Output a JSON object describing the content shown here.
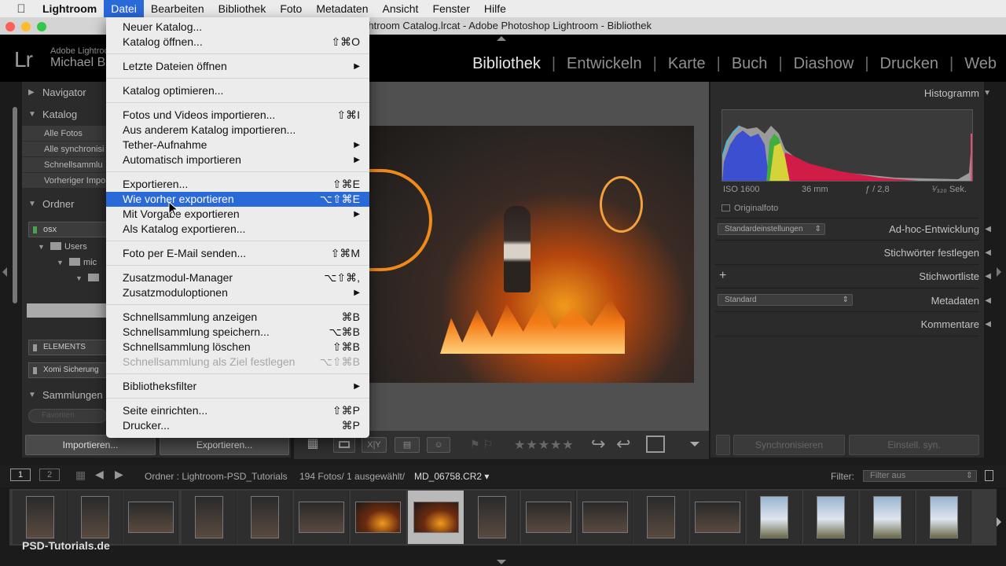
{
  "menubar": {
    "apple": "",
    "items": [
      "Lightroom",
      "Datei",
      "Bearbeiten",
      "Bibliothek",
      "Foto",
      "Metadaten",
      "Ansicht",
      "Fenster",
      "Hilfe"
    ]
  },
  "window": {
    "title": "Lightroom Catalog.lrcat - Adobe Photoshop Lightroom - Bibliothek"
  },
  "identity": {
    "logo": "Lr",
    "brand": "Adobe Lightroom",
    "user": "Michael B"
  },
  "modules": [
    "Bibliothek",
    "Entwickeln",
    "Karte",
    "Buch",
    "Diashow",
    "Drucken",
    "Web"
  ],
  "left_panel": {
    "navigator": "Navigator",
    "katalog": "Katalog",
    "katalog_items": [
      "Alle Fotos",
      "Alle synchronisi",
      "Schnellsammlu",
      "Vorheriger Impo"
    ],
    "ordner": "Ordner",
    "volume": "osx",
    "tree": [
      "Users",
      "mic"
    ],
    "volume2": "ELEMENTS",
    "volume3": "Xomi Sicherung",
    "sammlungen": "Sammlungen",
    "search_placeholder": "Favoriten",
    "import_btn": "Importieren...",
    "export_btn": "Exportieren..."
  },
  "dropdown": {
    "items": [
      {
        "label": "Neuer Katalog...",
        "shortcut": "",
        "sub": false,
        "state": "normal"
      },
      {
        "label": "Katalog öffnen...",
        "shortcut": "⇧⌘O",
        "sub": false,
        "state": "normal"
      },
      {
        "label": "Letzte Dateien öffnen",
        "shortcut": "",
        "sub": true,
        "state": "normal"
      },
      {
        "label": "Katalog optimieren...",
        "shortcut": "",
        "sub": false,
        "state": "normal"
      },
      {
        "label": "Fotos und Videos importieren...",
        "shortcut": "⇧⌘I",
        "sub": false,
        "state": "normal"
      },
      {
        "label": "Aus anderem Katalog importieren...",
        "shortcut": "",
        "sub": false,
        "state": "normal"
      },
      {
        "label": "Tether-Aufnahme",
        "shortcut": "",
        "sub": true,
        "state": "normal"
      },
      {
        "label": "Automatisch importieren",
        "shortcut": "",
        "sub": true,
        "state": "normal"
      },
      {
        "label": "Exportieren...",
        "shortcut": "⇧⌘E",
        "sub": false,
        "state": "normal"
      },
      {
        "label": "Wie vorher exportieren",
        "shortcut": "⌥⇧⌘E",
        "sub": false,
        "state": "highlighted"
      },
      {
        "label": "Mit Vorgabe exportieren",
        "shortcut": "",
        "sub": true,
        "state": "normal"
      },
      {
        "label": "Als Katalog exportieren...",
        "shortcut": "",
        "sub": false,
        "state": "normal"
      },
      {
        "label": "Foto per E-Mail senden...",
        "shortcut": "⇧⌘M",
        "sub": false,
        "state": "normal"
      },
      {
        "label": "Zusatzmodul-Manager",
        "shortcut": "⌥⇧⌘,",
        "sub": false,
        "state": "normal"
      },
      {
        "label": "Zusatzmoduloptionen",
        "shortcut": "",
        "sub": true,
        "state": "normal"
      },
      {
        "label": "Schnellsammlung anzeigen",
        "shortcut": "⌘B",
        "sub": false,
        "state": "normal"
      },
      {
        "label": "Schnellsammlung speichern...",
        "shortcut": "⌥⌘B",
        "sub": false,
        "state": "normal"
      },
      {
        "label": "Schnellsammlung löschen",
        "shortcut": "⇧⌘B",
        "sub": false,
        "state": "normal"
      },
      {
        "label": "Schnellsammlung als Ziel festlegen",
        "shortcut": "⌥⇧⌘B",
        "sub": false,
        "state": "disabled"
      },
      {
        "label": "Bibliotheksfilter",
        "shortcut": "",
        "sub": true,
        "state": "normal"
      },
      {
        "label": "Seite einrichten...",
        "shortcut": "⇧⌘P",
        "sub": false,
        "state": "normal"
      },
      {
        "label": "Drucker...",
        "shortcut": "⌘P",
        "sub": false,
        "state": "normal"
      }
    ]
  },
  "right_panel": {
    "histogram": "Histogramm",
    "iso": "ISO 1600",
    "focal": "36 mm",
    "aperture": "ƒ / 2,8",
    "shutter": "¹⁄₃₂₀ Sek.",
    "originalfoto": "Originalfoto",
    "preset": "Standardeinstellungen",
    "adhoc": "Ad-hoc-Entwicklung",
    "keywords": "Stichwörter festlegen",
    "keywordlist": "Stichwortliste",
    "meta_preset": "Standard",
    "metadata": "Metadaten",
    "comments": "Kommentare",
    "sync_btn": "Synchronisieren",
    "settings_btn": "Einstell. syn."
  },
  "toolbar": {
    "stars": "★★★★★",
    "xy": "X|Y"
  },
  "filmstrip_bar": {
    "page1": "1",
    "page2": "2",
    "path": "Ordner : Lightroom-PSD_Tutorials",
    "count": "194 Fotos/  1 ausgewählt/",
    "file": "MD_06758.CR2 ▾",
    "filter_label": "Filter:",
    "filter_value": "Filter aus"
  },
  "watermark": "PSD-Tutorials.de",
  "colors": {
    "accent": "#2a69d8",
    "menubar": "#ececec",
    "panel": "#2b2b2b"
  }
}
